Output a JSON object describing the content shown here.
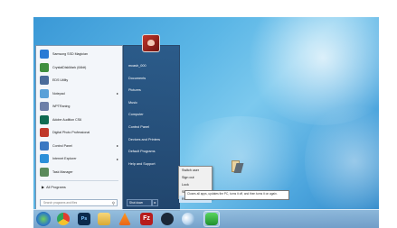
{
  "start_menu": {
    "pinned": [
      {
        "label": "Samsung SSD Magician",
        "icon": "samsung-ssd-icon",
        "color": "#2a7bd5",
        "arrow": false
      },
      {
        "label": "CrystalDiskMark (64bit)",
        "icon": "crystaldiskmark-icon",
        "color": "#3f8f3f",
        "arrow": false
      },
      {
        "label": "EDS Utility",
        "icon": "eds-utility-icon",
        "color": "#4a6b9a",
        "arrow": false
      },
      {
        "label": "Notepad",
        "icon": "notepad-icon",
        "color": "#5aa0d8",
        "arrow": true
      },
      {
        "label": "WPTRaning",
        "icon": "wpt-icon",
        "color": "#6d7fa8",
        "arrow": false
      },
      {
        "label": "Adobe Audition CS6",
        "icon": "adobe-audition-icon",
        "color": "#0f6b52",
        "arrow": false
      },
      {
        "label": "Digital Photo Professional",
        "icon": "digital-photo-icon",
        "color": "#c0392b",
        "arrow": false
      },
      {
        "label": "Control Panel",
        "icon": "control-panel-icon",
        "color": "#3b78c2",
        "arrow": true
      },
      {
        "label": "Internet Explorer",
        "icon": "internet-explorer-icon",
        "color": "#2c8fd8",
        "arrow": true
      },
      {
        "label": "Task Manager",
        "icon": "task-manager-icon",
        "color": "#5a8a5a",
        "arrow": false
      }
    ],
    "all_programs": "All Programs",
    "search_placeholder": "Search programs and files",
    "right_items": [
      "mcash_000",
      "Documents",
      "Pictures",
      "Music",
      "Computer",
      "Control Panel",
      "Devices and Printers",
      "Default Programs",
      "Help and Support"
    ],
    "shutdown_label": "Shut down"
  },
  "power_menu": {
    "items": [
      "Switch user",
      "Sign out",
      "Lock",
      "Sleep",
      "Restart"
    ]
  },
  "tooltip": {
    "text": "Closes all apps, updates the PC, turns it off, and then turns it on again."
  },
  "taskbar": {
    "items": [
      "start-orb",
      "chrome",
      "photoshop",
      "file-explorer",
      "vlc",
      "filezilla",
      "steam",
      "moon-app",
      "green-app"
    ],
    "photoshop_label": "Ps",
    "filezilla_label": "Fz"
  },
  "colors": {
    "desktop": "#4aa3dc",
    "start_right_pane": "#285482",
    "taskbar": "#8fb5d8"
  }
}
